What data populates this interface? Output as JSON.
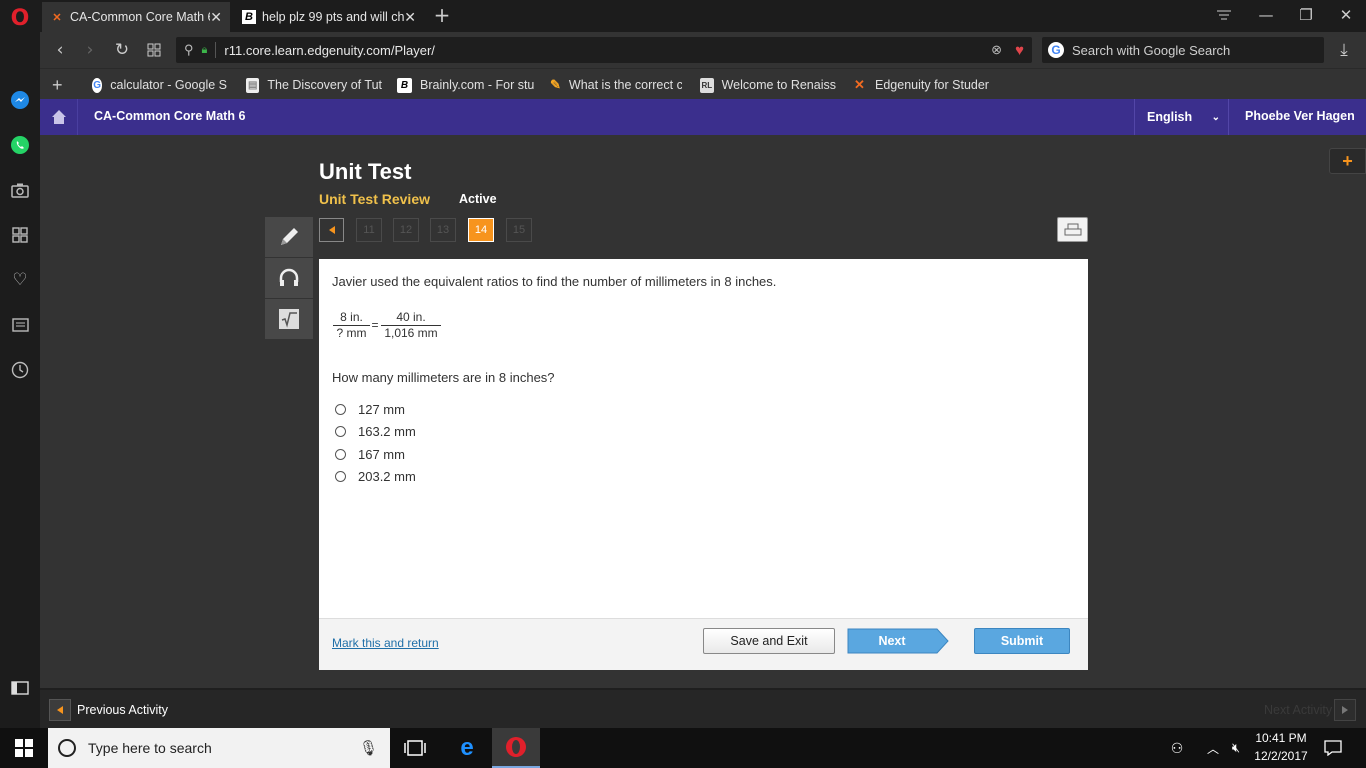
{
  "browser": {
    "tabs": [
      {
        "label": "CA-Common Core Math 6",
        "icon": "edgenuity-x-icon",
        "active": true
      },
      {
        "label": "help plz 99 pts and will ch",
        "icon": "brainly-b-icon",
        "active": false
      }
    ],
    "url": "r11.core.learn.edgenuity.com/Player/",
    "search_placeholder": "Search with Google Search",
    "bookmarks": [
      {
        "label": "calculator - Google S",
        "icon": "google-icon"
      },
      {
        "label": "The Discovery of Tut",
        "icon": "document-icon"
      },
      {
        "label": "Brainly.com - For stu",
        "icon": "brainly-b-icon"
      },
      {
        "label": "What is the correct c",
        "icon": "pencil-icon"
      },
      {
        "label": "Welcome to Renaiss",
        "icon": "rl-icon"
      },
      {
        "label": "Edgenuity for Studer",
        "icon": "edgenuity-x-icon"
      }
    ]
  },
  "app": {
    "course_title": "CA-Common Core Math 6",
    "language": "English",
    "user_name": "Phoebe Ver Hagen"
  },
  "activity": {
    "title": "Unit Test",
    "subtitle": "Unit Test Review",
    "status": "Active",
    "question_numbers": [
      "11",
      "12",
      "13",
      "14",
      "15"
    ],
    "current_question": "14"
  },
  "question": {
    "prompt": "Javier used the equivalent ratios to find the number of millimeters in 8 inches.",
    "fraction_left_num": "8 in.",
    "fraction_left_den": "? mm",
    "equals": "=",
    "fraction_right_num": "40 in.",
    "fraction_right_den": "1,016 mm",
    "ask": "How many millimeters are in 8 inches?",
    "choices": [
      "127 mm",
      "163.2 mm",
      "167 mm",
      "203.2 mm"
    ]
  },
  "footer": {
    "mark_link": "Mark this and return",
    "save_exit": "Save and Exit",
    "next": "Next",
    "submit": "Submit"
  },
  "activity_nav": {
    "previous": "Previous Activity",
    "next": "Next Activity"
  },
  "taskbar": {
    "search_placeholder": "Type here to search",
    "time": "10:41 PM",
    "date": "12/2/2017"
  },
  "colors": {
    "header_purple": "#3b2f8d",
    "current_question_orange": "#f7941d",
    "subtitle_gold": "#f0c14b",
    "button_blue": "#5aa7e0"
  }
}
